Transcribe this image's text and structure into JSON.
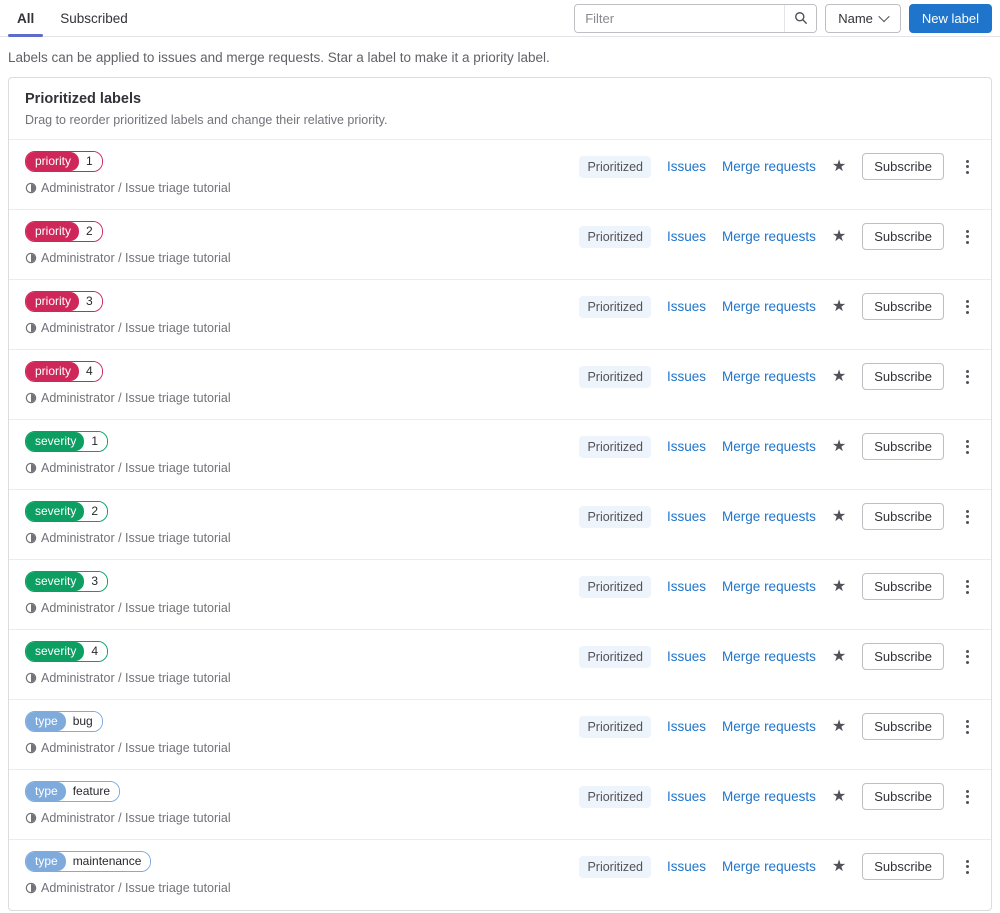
{
  "tabs": [
    {
      "label": "All",
      "active": true
    },
    {
      "label": "Subscribed",
      "active": false
    }
  ],
  "toolbar": {
    "filter_placeholder": "Filter",
    "sort_button": "Name",
    "new_label_button": "New label"
  },
  "description": "Labels can be applied to issues and merge requests. Star a label to make it a priority label.",
  "prioritized_card": {
    "title": "Prioritized labels",
    "subtitle": "Drag to reorder prioritized labels and change their relative priority."
  },
  "row_common": {
    "project": "Administrator / Issue triage tutorial",
    "prioritized_badge": "Prioritized",
    "issues_link": "Issues",
    "merge_requests_link": "Merge requests",
    "subscribe_button": "Subscribe"
  },
  "labels": [
    {
      "scope": "priority",
      "value": "1",
      "color": "#d0275a"
    },
    {
      "scope": "priority",
      "value": "2",
      "color": "#d0275a"
    },
    {
      "scope": "priority",
      "value": "3",
      "color": "#d0275a"
    },
    {
      "scope": "priority",
      "value": "4",
      "color": "#d0275a"
    },
    {
      "scope": "severity",
      "value": "1",
      "color": "#0d9f61"
    },
    {
      "scope": "severity",
      "value": "2",
      "color": "#0d9f61"
    },
    {
      "scope": "severity",
      "value": "3",
      "color": "#0d9f61"
    },
    {
      "scope": "severity",
      "value": "4",
      "color": "#0d9f61"
    },
    {
      "scope": "type",
      "value": "bug",
      "color": "#7fabdc"
    },
    {
      "scope": "type",
      "value": "feature",
      "color": "#7fabdc"
    },
    {
      "scope": "type",
      "value": "maintenance",
      "color": "#7fabdc"
    }
  ],
  "icons": {
    "star": "★",
    "search": "magnifier",
    "sort_chevron": "chevron-down",
    "row_menu": "vertical-ellipsis",
    "project_prefix": "half-filled-circle"
  },
  "colors": {
    "accent_blue": "#1f75cb",
    "tab_indicator": "#5b6cc9",
    "priority_red": "#d0275a",
    "severity_green": "#0d9f61",
    "type_blue": "#7fabdc",
    "muted_text": "#737278",
    "border": "#dcdcde"
  }
}
